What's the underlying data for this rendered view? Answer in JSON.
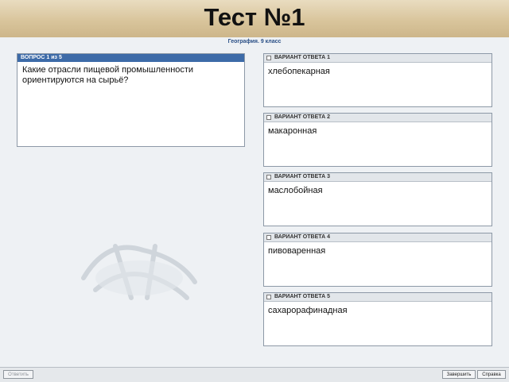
{
  "header": {
    "title": "Тест №1",
    "subject": "География. 9 класс"
  },
  "question": {
    "heading": "ВОПРОС 1 из 5",
    "text_line1": "Какие отрасли пищевой промышленности",
    "text_line2": "ориентируются на сырьё?"
  },
  "answers": [
    {
      "heading": "ВАРИАНТ ОТВЕТА 1",
      "text": "хлебопекарная"
    },
    {
      "heading": "ВАРИАНТ ОТВЕТА 2",
      "text": "макаронная"
    },
    {
      "heading": "ВАРИАНТ ОТВЕТА 3",
      "text": "маслобойная"
    },
    {
      "heading": "ВАРИАНТ ОТВЕТА 4",
      "text": "пивоваренная"
    },
    {
      "heading": "ВАРИАНТ ОТВЕТА 5",
      "text": "сахарорафинадная"
    }
  ],
  "toolbar": {
    "answer_label": "Ответить",
    "finish_label": "Завершить",
    "help_label": "Справка"
  },
  "colors": {
    "header_bar": "#3d6ba8",
    "subject_text": "#2a4f86",
    "banner": "#d9c59c"
  }
}
